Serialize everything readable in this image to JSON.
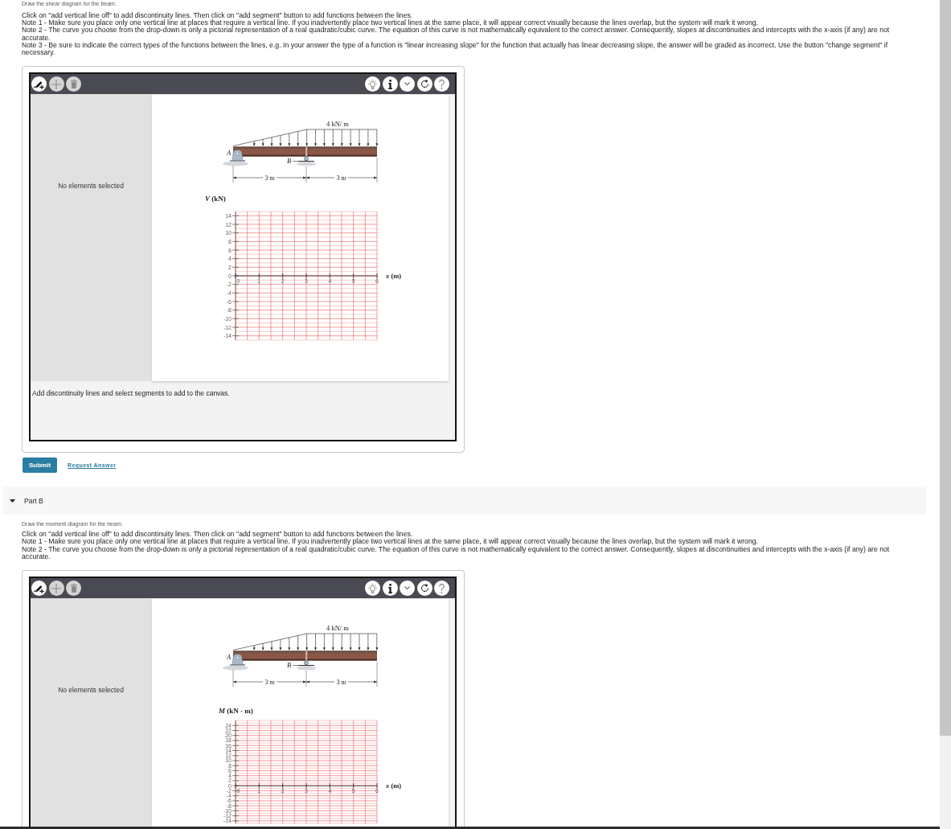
{
  "part_a": {
    "prompt": "Draw the shear diagram for the beam.",
    "instructions": [
      "Click on \"add vertical line off\" to add discontinuity lines. Then click on \"add segment\" button to add functions between the lines.",
      "Note 1 - Make sure you place only one vertical line at places that require a vertical line. If you inadvertently place two vertical lines at the same place, it will appear correct visually because the lines overlap, but the system will mark it wrong.",
      "Note 2 - The curve you choose from the drop-down is only a pictorial representation of a real quadratic/cubic curve. The equation of this curve is not mathematically equivalent to the correct answer. Consequently, slopes at discontinuities and intercepts with the x-axis (if any) are not accurate.",
      "Note 3 - Be sure to indicate the correct types of the functions between the lines, e.g. In your answer the type of a function is \"linear increasing slope\" for the function that actually has linear decreasing slope, the answer will be graded as incorrect. Use the button \"change segment\" if necessary."
    ],
    "widget": {
      "left_tools": [
        {
          "kind": "pencil",
          "disabled": false
        },
        {
          "kind": "plus",
          "disabled": true
        },
        {
          "kind": "trash",
          "disabled": true
        }
      ],
      "right_tools": [
        {
          "kind": "bulb"
        },
        {
          "kind": "info"
        },
        {
          "kind": "chevron"
        },
        {
          "kind": "redo"
        },
        {
          "kind": "help"
        }
      ],
      "panel_text": "No elements selected",
      "figure": {
        "load_label": "4 kN/ m",
        "support_labels": [
          "A",
          "B"
        ],
        "span_labels": [
          "3 m",
          "3 m"
        ]
      },
      "chart_data": {
        "type": "line",
        "xlabel": "*x* (m)",
        "ylabel": "*V* (kN)",
        "xlim": [
          0,
          6
        ],
        "ylim": [
          -15,
          15
        ],
        "xticks": [
          0,
          1,
          2,
          3,
          4,
          5,
          6
        ],
        "yticks": [
          -14,
          -12,
          -10,
          -8,
          -6,
          -4,
          -2,
          0,
          2,
          4,
          6,
          8,
          10,
          12,
          14
        ],
        "grid": true
      },
      "status_text": "Add discontinuity lines and select segments to add to the canvas."
    },
    "submit": "Submit",
    "request_answer": "Request Answer"
  },
  "part_b": {
    "title": "Part B",
    "expanded": true,
    "prompt": "Draw the moment diagram for the beam.",
    "instructions": [
      "Click on \"add vertical line off\" to add discontinuity lines. Then click on \"add segment\" button to add functions between the lines.",
      "Note 1 - Make sure you place only one vertical line at places that require a vertical line. If you inadvertently place two vertical lines at the same place, it will appear correct visually because the lines overlap, but the system will mark it wrong.",
      "Note 2 - The curve you choose from the drop-down is only a pictorial representation of a real quadratic/cubic curve. The equation of this curve is not mathematically equivalent to the correct answer. Consequently, slopes at discontinuities and intercepts with the x-axis (if any) are not accurate."
    ],
    "widget": {
      "left_tools": [
        {
          "kind": "pencil",
          "disabled": false
        },
        {
          "kind": "plus",
          "disabled": true
        },
        {
          "kind": "trash",
          "disabled": true
        }
      ],
      "right_tools": [
        {
          "kind": "bulb"
        },
        {
          "kind": "info"
        },
        {
          "kind": "chevron"
        },
        {
          "kind": "redo"
        },
        {
          "kind": "help"
        }
      ],
      "panel_text": "No elements selected",
      "figure": {
        "load_label": "4 kN/ m",
        "support_labels": [
          "A",
          "B"
        ],
        "span_labels": [
          "3 m",
          "3 m"
        ]
      },
      "chart_data": {
        "type": "line",
        "xlabel": "*x* (m)",
        "ylabel": "*M* (kN · m)",
        "xlim": [
          0,
          6
        ],
        "ylim": [
          -15,
          26
        ],
        "xticks": [
          0,
          1,
          2,
          3,
          4,
          5,
          6
        ],
        "yticks": [
          -14,
          -12,
          -10,
          -8,
          -6,
          -4,
          -2,
          0,
          2,
          4,
          6,
          8,
          10,
          12,
          14,
          16,
          18,
          20,
          22,
          24
        ],
        "grid": true
      }
    }
  }
}
